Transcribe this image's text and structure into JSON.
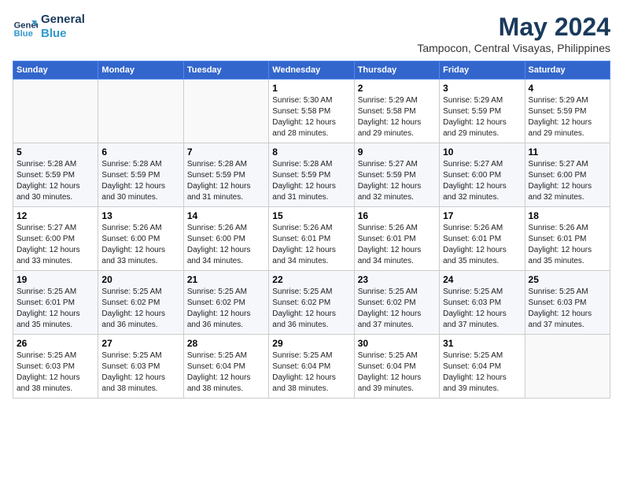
{
  "header": {
    "logo_line1": "General",
    "logo_line2": "Blue",
    "month": "May 2024",
    "location": "Tampocon, Central Visayas, Philippines"
  },
  "weekdays": [
    "Sunday",
    "Monday",
    "Tuesday",
    "Wednesday",
    "Thursday",
    "Friday",
    "Saturday"
  ],
  "weeks": [
    [
      {
        "day": "",
        "info": ""
      },
      {
        "day": "",
        "info": ""
      },
      {
        "day": "",
        "info": ""
      },
      {
        "day": "1",
        "info": "Sunrise: 5:30 AM\nSunset: 5:58 PM\nDaylight: 12 hours\nand 28 minutes."
      },
      {
        "day": "2",
        "info": "Sunrise: 5:29 AM\nSunset: 5:58 PM\nDaylight: 12 hours\nand 29 minutes."
      },
      {
        "day": "3",
        "info": "Sunrise: 5:29 AM\nSunset: 5:59 PM\nDaylight: 12 hours\nand 29 minutes."
      },
      {
        "day": "4",
        "info": "Sunrise: 5:29 AM\nSunset: 5:59 PM\nDaylight: 12 hours\nand 29 minutes."
      }
    ],
    [
      {
        "day": "5",
        "info": "Sunrise: 5:28 AM\nSunset: 5:59 PM\nDaylight: 12 hours\nand 30 minutes."
      },
      {
        "day": "6",
        "info": "Sunrise: 5:28 AM\nSunset: 5:59 PM\nDaylight: 12 hours\nand 30 minutes."
      },
      {
        "day": "7",
        "info": "Sunrise: 5:28 AM\nSunset: 5:59 PM\nDaylight: 12 hours\nand 31 minutes."
      },
      {
        "day": "8",
        "info": "Sunrise: 5:28 AM\nSunset: 5:59 PM\nDaylight: 12 hours\nand 31 minutes."
      },
      {
        "day": "9",
        "info": "Sunrise: 5:27 AM\nSunset: 5:59 PM\nDaylight: 12 hours\nand 32 minutes."
      },
      {
        "day": "10",
        "info": "Sunrise: 5:27 AM\nSunset: 6:00 PM\nDaylight: 12 hours\nand 32 minutes."
      },
      {
        "day": "11",
        "info": "Sunrise: 5:27 AM\nSunset: 6:00 PM\nDaylight: 12 hours\nand 32 minutes."
      }
    ],
    [
      {
        "day": "12",
        "info": "Sunrise: 5:27 AM\nSunset: 6:00 PM\nDaylight: 12 hours\nand 33 minutes."
      },
      {
        "day": "13",
        "info": "Sunrise: 5:26 AM\nSunset: 6:00 PM\nDaylight: 12 hours\nand 33 minutes."
      },
      {
        "day": "14",
        "info": "Sunrise: 5:26 AM\nSunset: 6:00 PM\nDaylight: 12 hours\nand 34 minutes."
      },
      {
        "day": "15",
        "info": "Sunrise: 5:26 AM\nSunset: 6:01 PM\nDaylight: 12 hours\nand 34 minutes."
      },
      {
        "day": "16",
        "info": "Sunrise: 5:26 AM\nSunset: 6:01 PM\nDaylight: 12 hours\nand 34 minutes."
      },
      {
        "day": "17",
        "info": "Sunrise: 5:26 AM\nSunset: 6:01 PM\nDaylight: 12 hours\nand 35 minutes."
      },
      {
        "day": "18",
        "info": "Sunrise: 5:26 AM\nSunset: 6:01 PM\nDaylight: 12 hours\nand 35 minutes."
      }
    ],
    [
      {
        "day": "19",
        "info": "Sunrise: 5:25 AM\nSunset: 6:01 PM\nDaylight: 12 hours\nand 35 minutes."
      },
      {
        "day": "20",
        "info": "Sunrise: 5:25 AM\nSunset: 6:02 PM\nDaylight: 12 hours\nand 36 minutes."
      },
      {
        "day": "21",
        "info": "Sunrise: 5:25 AM\nSunset: 6:02 PM\nDaylight: 12 hours\nand 36 minutes."
      },
      {
        "day": "22",
        "info": "Sunrise: 5:25 AM\nSunset: 6:02 PM\nDaylight: 12 hours\nand 36 minutes."
      },
      {
        "day": "23",
        "info": "Sunrise: 5:25 AM\nSunset: 6:02 PM\nDaylight: 12 hours\nand 37 minutes."
      },
      {
        "day": "24",
        "info": "Sunrise: 5:25 AM\nSunset: 6:03 PM\nDaylight: 12 hours\nand 37 minutes."
      },
      {
        "day": "25",
        "info": "Sunrise: 5:25 AM\nSunset: 6:03 PM\nDaylight: 12 hours\nand 37 minutes."
      }
    ],
    [
      {
        "day": "26",
        "info": "Sunrise: 5:25 AM\nSunset: 6:03 PM\nDaylight: 12 hours\nand 38 minutes."
      },
      {
        "day": "27",
        "info": "Sunrise: 5:25 AM\nSunset: 6:03 PM\nDaylight: 12 hours\nand 38 minutes."
      },
      {
        "day": "28",
        "info": "Sunrise: 5:25 AM\nSunset: 6:04 PM\nDaylight: 12 hours\nand 38 minutes."
      },
      {
        "day": "29",
        "info": "Sunrise: 5:25 AM\nSunset: 6:04 PM\nDaylight: 12 hours\nand 38 minutes."
      },
      {
        "day": "30",
        "info": "Sunrise: 5:25 AM\nSunset: 6:04 PM\nDaylight: 12 hours\nand 39 minutes."
      },
      {
        "day": "31",
        "info": "Sunrise: 5:25 AM\nSunset: 6:04 PM\nDaylight: 12 hours\nand 39 minutes."
      },
      {
        "day": "",
        "info": ""
      }
    ]
  ]
}
